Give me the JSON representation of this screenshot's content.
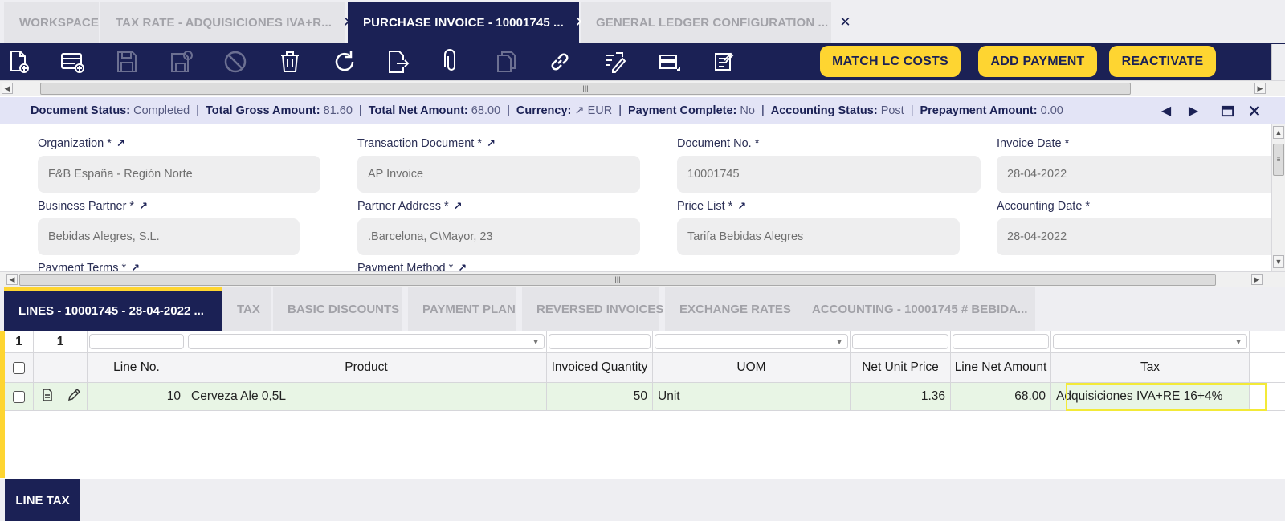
{
  "tabs": [
    {
      "label": "WORKSPACE",
      "closable": false
    },
    {
      "label": "TAX RATE - ADQUISICIONES IVA+R...",
      "closable": true
    },
    {
      "label": "PURCHASE INVOICE - 10001745 ...",
      "closable": true,
      "active": true
    },
    {
      "label": "GENERAL LEDGER CONFIGURATION ...",
      "closable": true
    }
  ],
  "tab_close_glyph": "✕",
  "toolbar": {
    "icons": [
      "new-document-icon",
      "new-row-icon",
      "save-icon",
      "save-close-icon",
      "cancel-icon",
      "delete-icon",
      "refresh-icon",
      "export-icon",
      "attachment-icon",
      "clone-icon",
      "link-icon",
      "audit-icon",
      "grid-view-icon",
      "notes-icon"
    ],
    "match_lc_costs": "MATCH LC COSTS",
    "add_payment": "ADD PAYMENT",
    "reactivate": "REACTIVATE"
  },
  "status": {
    "document_status_label": "Document Status:",
    "document_status": "Completed",
    "total_gross_label": "Total Gross Amount:",
    "total_gross": "81.60",
    "total_net_label": "Total Net Amount:",
    "total_net": "68.00",
    "currency_label": "Currency:",
    "currency": "EUR",
    "payment_complete_label": "Payment Complete:",
    "payment_complete": "No",
    "accounting_status_label": "Accounting Status:",
    "accounting_status": "Post",
    "prepayment_label": "Prepayment Amount:",
    "prepayment": "0.00",
    "separator": "|"
  },
  "form": {
    "organization": {
      "label": "Organization",
      "value": "F&B España - Región Norte"
    },
    "transaction_document": {
      "label": "Transaction Document",
      "value": "AP Invoice"
    },
    "document_no": {
      "label": "Document No.",
      "value": "10001745"
    },
    "invoice_date": {
      "label": "Invoice Date",
      "value": "28-04-2022"
    },
    "business_partner": {
      "label": "Business Partner",
      "value": "Bebidas Alegres, S.L."
    },
    "partner_address": {
      "label": "Partner Address",
      "value": ".Barcelona, C\\Mayor, 23"
    },
    "price_list": {
      "label": "Price List",
      "value": "Tarifa Bebidas Alegres"
    },
    "accounting_date": {
      "label": "Accounting Date",
      "value": "28-04-2022"
    },
    "payment_terms": {
      "label": "Payment Terms"
    },
    "payment_method": {
      "label": "Payment Method"
    },
    "required_mark": "*"
  },
  "subtabs": [
    {
      "label": "LINES - 10001745 - 28-04-2022 ...",
      "active": true
    },
    {
      "label": "TAX"
    },
    {
      "label": "BASIC DISCOUNTS"
    },
    {
      "label": "PAYMENT PLAN"
    },
    {
      "label": "REVERSED INVOICES"
    },
    {
      "label": "EXCHANGE RATES"
    },
    {
      "label": "ACCOUNTING - 10001745 # BEBIDA..."
    }
  ],
  "grid": {
    "selected_count": "1",
    "total_count": "1",
    "columns": [
      "Line No.",
      "Product",
      "Invoiced Quantity",
      "UOM",
      "Net Unit Price",
      "Line Net Amount",
      "Tax"
    ],
    "rows": [
      {
        "line_no": "10",
        "product": "Cerveza Ale 0,5L",
        "invoiced_quantity": "50",
        "uom": "Unit",
        "net_unit_price": "1.36",
        "line_net_amount": "68.00",
        "tax": "Adquisiciones IVA+RE 16+4%"
      }
    ]
  },
  "bottom_tab": "LINE TAX",
  "colors": {
    "navy": "#1b2155",
    "yellow": "#fed531",
    "highlight": "#f3ea37",
    "row_green": "#e8f5e5"
  }
}
